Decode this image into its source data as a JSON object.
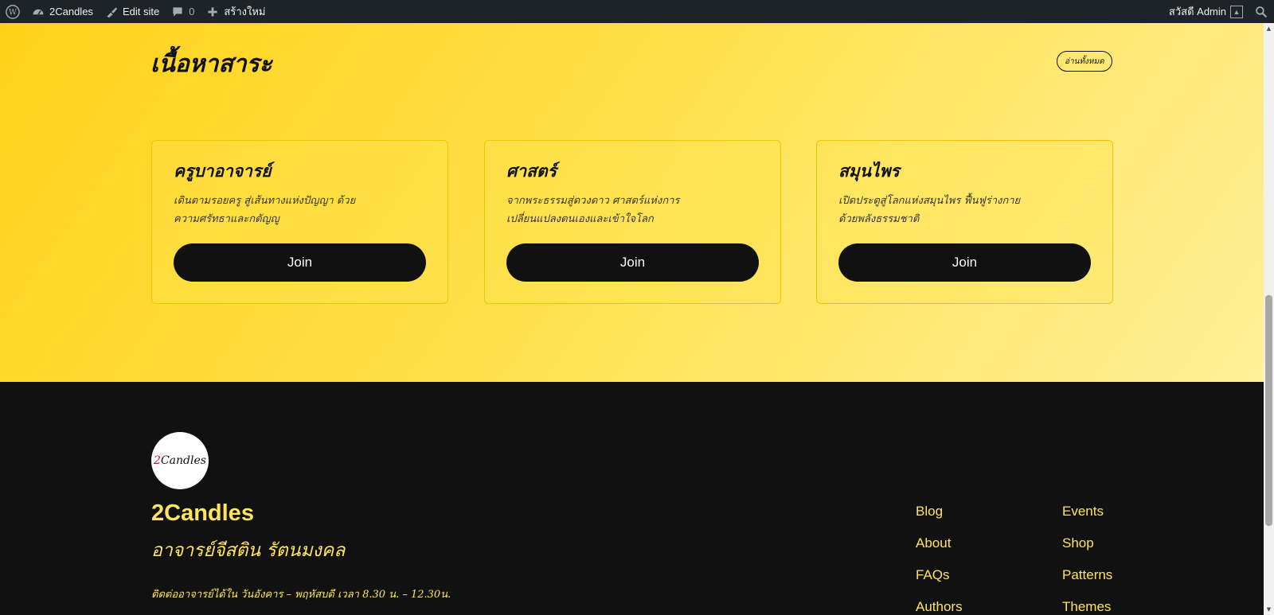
{
  "admin_bar": {
    "site_name": "2Candles",
    "edit_site": "Edit site",
    "comments_count": "0",
    "new_label": "สร้างใหม่",
    "greeting": "สวัสดี Admin",
    "icons": [
      "wordpress-logo-icon",
      "dashboard-icon",
      "brush-icon",
      "comment-icon",
      "plus-icon",
      "search-icon"
    ]
  },
  "featured": {
    "title": "เนื้อหาสาระ",
    "read_all": "อ่านทั้งหมด",
    "cards": [
      {
        "title": "ครูบาอาจารย์",
        "description": "เดินตามรอยครู สู่เส้นทางแห่งปัญญา ด้วยความศรัทธาและกตัญญู",
        "button": "Join"
      },
      {
        "title": "ศาสตร์",
        "description": "จากพระธรรมสู่ดวงดาว ศาสตร์แห่งการเปลี่ยนแปลงตนเองและเข้าใจโลก",
        "button": "Join"
      },
      {
        "title": "สมุนไพร",
        "description": "เปิดประตูสู่โลกแห่งสมุนไพร ฟื้นฟูร่างกายด้วยพลังธรรมชาติ",
        "button": "Join"
      }
    ]
  },
  "footer": {
    "logo_text_num": "2",
    "logo_text": "Candles",
    "site_name": "2Candles",
    "tagline": "อาจารย์จีสติน รัตนมงคล",
    "contact": "ติดต่ออาจารย์ได้ใน วันอังคาร – พฤหัสบดี เวลา 8.30 น. – 12.30น.",
    "nav_col1": [
      "Blog",
      "About",
      "FAQs",
      "Authors"
    ],
    "nav_col2": [
      "Events",
      "Shop",
      "Patterns",
      "Themes"
    ]
  },
  "colors": {
    "accent_yellow": "#ffd21a",
    "footer_text": "#ffe45c",
    "dark": "#111111"
  }
}
